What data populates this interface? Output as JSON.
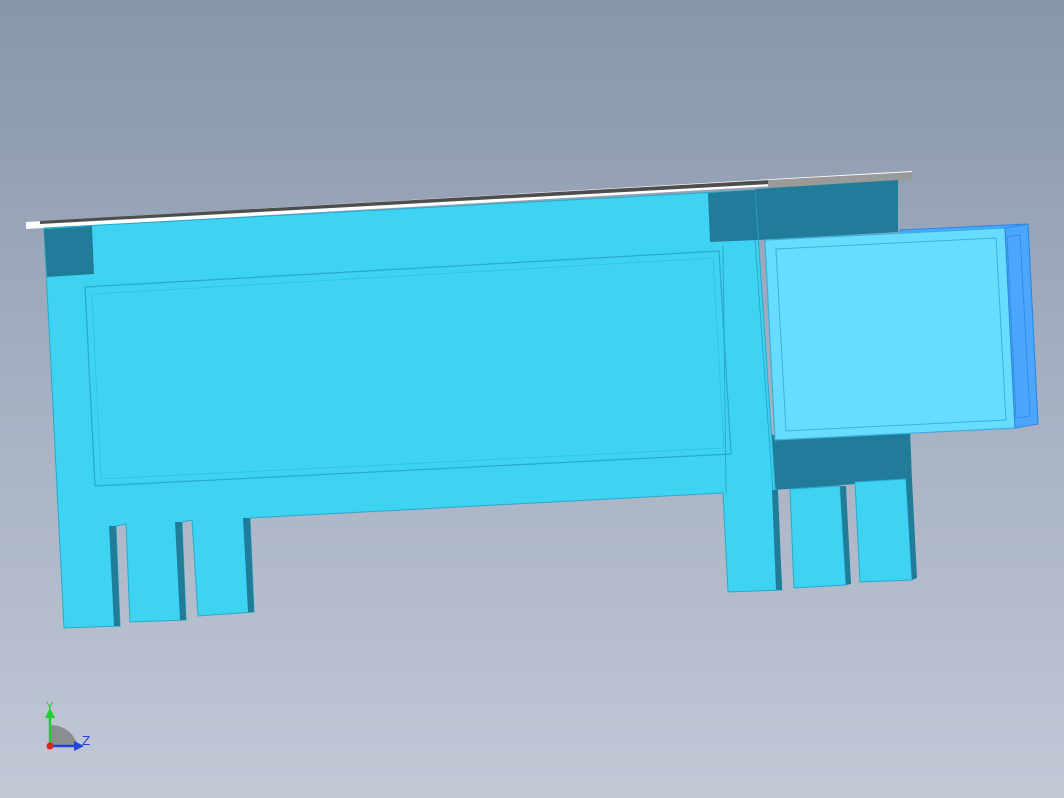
{
  "viewport": {
    "background_top": "#8796aa",
    "background_bottom": "#c2c8d6"
  },
  "model": {
    "face_color": "#3ed3f3",
    "shadow_color": "#217c9a",
    "highlight_panel_color": "#67dcff",
    "side_panel_color": "#4aa6ff",
    "top_rail_color": "#ffffff",
    "top_rail_shadow": "#4e4e4e"
  },
  "triad": {
    "y_label": "Y",
    "z_label": "Z",
    "y_color": "#22cc33",
    "z_color": "#2244dd",
    "origin_color": "#dd2222"
  }
}
